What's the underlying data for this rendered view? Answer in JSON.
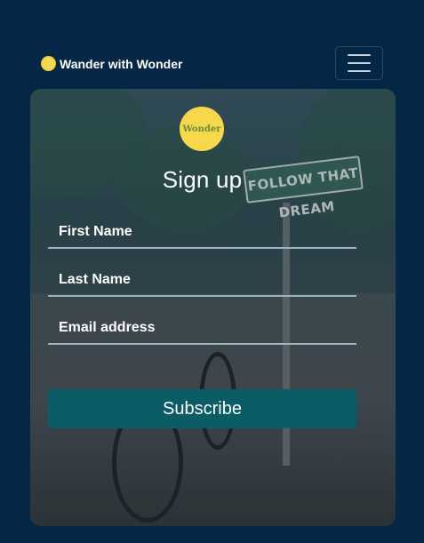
{
  "brand": {
    "name": "Wander with Wonder",
    "logo_icon": "yellow-circle-logo-icon"
  },
  "nav": {
    "menu_icon": "hamburger-menu-icon"
  },
  "card": {
    "logo_text": "Wonder",
    "title": "Sign up",
    "background_sign_text": "FOLLOW THAT DREAM",
    "fields": [
      {
        "label": "First Name"
      },
      {
        "label": "Last Name"
      },
      {
        "label": "Email address"
      }
    ],
    "submit_label": "Subscribe"
  },
  "colors": {
    "page_background": "#032744",
    "button_background": "#0a5d66",
    "logo_yellow": "#f6d84a"
  }
}
